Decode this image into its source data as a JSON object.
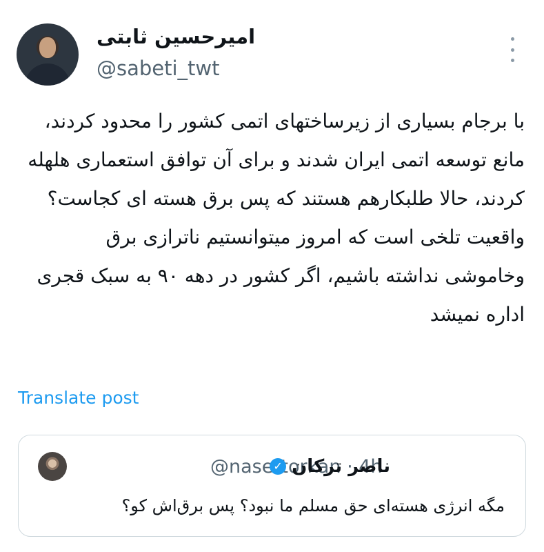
{
  "post": {
    "author": {
      "name": "امیرحسین ثابتی",
      "handle": "@sabeti_twt",
      "avatar_icon": "person-photo"
    },
    "more_icon": "vertical-dots-icon",
    "text_paragraphs": [
      "با برجام بسیاری از زیرساختهای اتمی کشور را محدود کردند، مانع توسعه اتمی ایران شدند و برای آن توافق استعماری هلهله کردند، حالا طلبکارهم هستند که پس برق هسته ای کجاست؟",
      "واقعیت تلخی است که امروز میتوانستیم ناترازی برق وخاموشی نداشته باشیم، اگر کشور در دهه ۹۰ به سبک قجری اداره نمیشد"
    ],
    "translate_label": "Translate post"
  },
  "quoted_post": {
    "author_name": "ناصر ترکان",
    "verified_glyph": "✓",
    "handle": "@nasertorkan",
    "separator": "·",
    "time": "4h",
    "text": "مگه انرژی هسته‌ای حق مسلم ما نبود؟ پس برق‌اش کو؟"
  },
  "colors": {
    "text": "#0f1419",
    "secondary": "#536471",
    "link": "#1d9bf0",
    "border": "#cfd9de",
    "verified": "#1d9bf0"
  }
}
